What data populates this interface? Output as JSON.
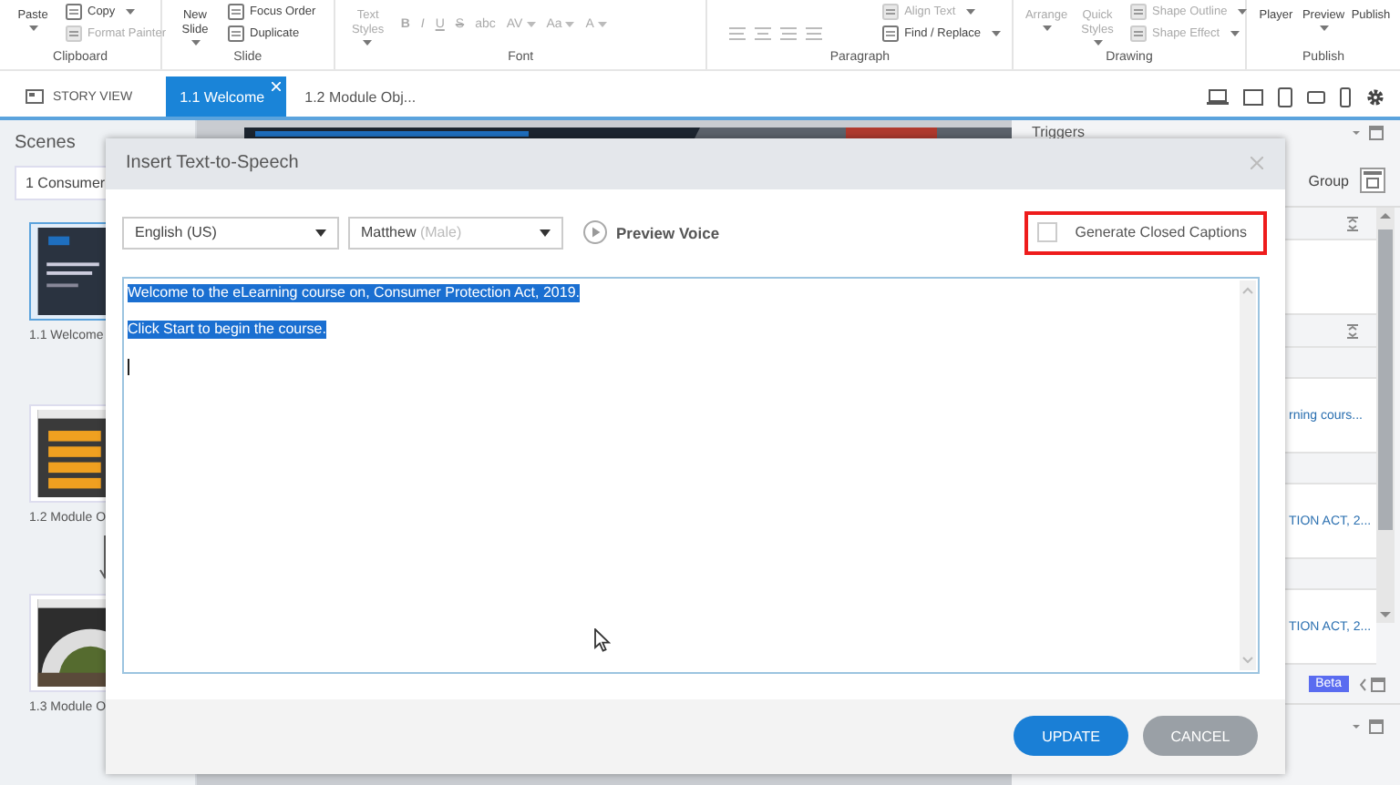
{
  "ribbon": {
    "groups": [
      {
        "label": "Clipboard",
        "columns": [
          {
            "kind": "large",
            "items": [
              {
                "label": "Paste",
                "disabled": false,
                "dropdown": true
              }
            ]
          },
          {
            "kind": "stack",
            "items": [
              {
                "label": "Copy",
                "disabled": false,
                "dropdown": true
              },
              {
                "label": "Format Painter",
                "disabled": true,
                "dropdown": false
              }
            ]
          }
        ]
      },
      {
        "label": "Slide",
        "columns": [
          {
            "kind": "large",
            "items": [
              {
                "label": "New Slide",
                "disabled": false,
                "dropdown": true
              }
            ]
          },
          {
            "kind": "stack",
            "items": [
              {
                "label": "Focus Order",
                "disabled": false,
                "dropdown": false
              },
              {
                "label": "Duplicate",
                "disabled": false,
                "dropdown": false
              }
            ]
          }
        ]
      },
      {
        "label": "Font",
        "columns": [
          {
            "kind": "large",
            "items": [
              {
                "label": "Text Styles",
                "disabled": true,
                "dropdown": true
              }
            ]
          },
          {
            "kind": "glyphs",
            "items": [
              {
                "label": "B",
                "disabled": true,
                "dropdown": false
              },
              {
                "label": "I",
                "disabled": true,
                "dropdown": false
              },
              {
                "label": "U",
                "disabled": true,
                "dropdown": false
              },
              {
                "label": "S",
                "disabled": true,
                "dropdown": false
              },
              {
                "label": "abc",
                "disabled": true,
                "dropdown": false
              },
              {
                "label": "AV",
                "disabled": true,
                "dropdown": true
              },
              {
                "label": "Aa",
                "disabled": true,
                "dropdown": true
              },
              {
                "label": "A",
                "disabled": true,
                "dropdown": true
              }
            ]
          }
        ]
      },
      {
        "label": "Paragraph",
        "columns": [
          {
            "kind": "align"
          },
          {
            "kind": "stack",
            "items": [
              {
                "label": "Align Text",
                "disabled": true,
                "dropdown": true
              },
              {
                "label": "Find / Replace",
                "disabled": false,
                "dropdown": true
              }
            ]
          }
        ]
      },
      {
        "label": "Drawing",
        "columns": [
          {
            "kind": "large",
            "items": [
              {
                "label": "Arrange",
                "disabled": true,
                "dropdown": true
              },
              {
                "label": "Quick Styles",
                "disabled": true,
                "dropdown": true
              }
            ]
          },
          {
            "kind": "stack",
            "items": [
              {
                "label": "Shape Outline",
                "disabled": true,
                "dropdown": true
              },
              {
                "label": "Shape Effect",
                "disabled": true,
                "dropdown": true
              }
            ]
          }
        ]
      },
      {
        "label": "Publish",
        "columns": [
          {
            "kind": "large",
            "items": [
              {
                "label": "Player",
                "disabled": false,
                "dropdown": false
              },
              {
                "label": "Preview",
                "disabled": false,
                "dropdown": true
              },
              {
                "label": "Publish",
                "disabled": false,
                "dropdown": false
              }
            ]
          }
        ]
      }
    ]
  },
  "tabs": [
    {
      "label": "STORY VIEW",
      "kind": "story",
      "selected": false,
      "closable": false
    },
    {
      "label": "1.1 Welcome",
      "kind": "slide",
      "selected": true,
      "closable": true
    },
    {
      "label": "1.2 Module Obj...",
      "kind": "slide",
      "selected": false,
      "closable": false
    }
  ],
  "scenes": {
    "title": "Scenes",
    "scene_select": "1 Consumer",
    "slides": [
      {
        "label": "1.1 Welcome",
        "selected": true,
        "arrow_after": false
      },
      {
        "label": "1.2 Module O",
        "selected": false,
        "arrow_after": true
      },
      {
        "label": "1.3 Module O",
        "selected": false,
        "arrow_after": false
      }
    ]
  },
  "right_panel": {
    "title": "Triggers",
    "group_button": "Group",
    "rows": [
      {
        "kind": "header"
      },
      {
        "kind": "blank"
      },
      {
        "kind": "header"
      },
      {
        "kind": "blank"
      },
      {
        "kind": "text",
        "text": "rning cours..."
      },
      {
        "kind": "blank"
      },
      {
        "kind": "text",
        "text": "TION ACT, 2..."
      },
      {
        "kind": "blank"
      },
      {
        "kind": "text",
        "text": "TION ACT, 2..."
      }
    ],
    "badge": "Beta"
  },
  "dialog": {
    "title": "Insert Text-to-Speech",
    "language": "English (US)",
    "voice": "Matthew",
    "voice_note": "(Male)",
    "preview_label": "Preview Voice",
    "captions": {
      "label": "Generate Closed Captions",
      "checked": false,
      "highlighted": true
    },
    "text_lines": [
      "Welcome to the eLearning course on, Consumer Protection Act, 2019.",
      "Click Start to begin the course."
    ],
    "text_selected": true,
    "buttons": [
      {
        "label": "UPDATE",
        "kind": "primary"
      },
      {
        "label": "CANCEL",
        "kind": "secondary"
      }
    ]
  }
}
